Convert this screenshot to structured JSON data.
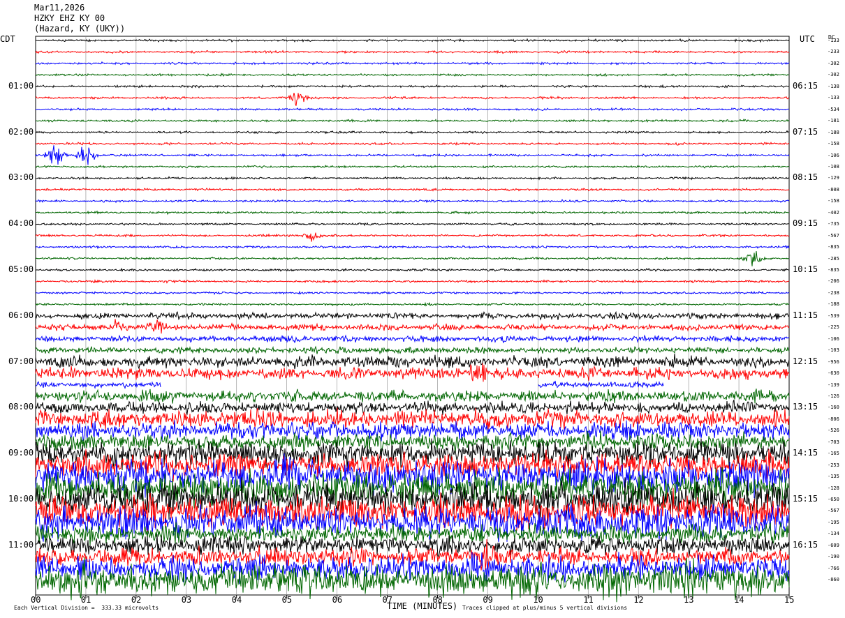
{
  "header": {
    "date": "Mar11,2026",
    "station": "HZKY EHZ KY 00",
    "location": "(Hazard, KY (UKY))"
  },
  "left_tz": "CDT",
  "right_tz": "UTC",
  "dc_label": "DC",
  "left_hours": [
    "01:00",
    "02:00",
    "03:00",
    "04:00",
    "05:00",
    "06:00",
    "07:00",
    "08:00",
    "09:00",
    "10:00",
    "11:00"
  ],
  "right_hours": [
    "06:15",
    "07:15",
    "08:15",
    "09:15",
    "10:15",
    "11:15",
    "12:15",
    "13:15",
    "14:15",
    "15:15",
    "16:15"
  ],
  "x_ticks": [
    "00",
    "01",
    "02",
    "03",
    "04",
    "05",
    "06",
    "07",
    "08",
    "09",
    "10",
    "11",
    "12",
    "13",
    "14",
    "15"
  ],
  "x_label": "TIME (MINUTES)",
  "footer_left": "Each Vertical Division =  333.33 microvolts",
  "footer_right": "Traces clipped at plus/minus 5 vertical divisions",
  "dc_offsets": [
    "-133",
    "-233",
    "-302",
    "-302",
    "-138",
    "-133",
    "-534",
    "-181",
    "-188",
    "-158",
    "-106",
    "-108",
    "-129",
    "-808",
    "-158",
    "-402",
    "-735",
    "-567",
    "-835",
    "-285",
    "-835",
    "-206",
    "-238",
    "-188",
    "-539",
    "-225",
    "-106",
    "-103",
    "-956",
    "-630",
    "-139",
    "-126",
    "-160",
    "-806",
    "-526",
    "-703",
    "-165",
    "-253",
    "-135",
    "-128",
    "-650",
    "-567",
    "-195",
    "-134",
    "-609",
    "-190",
    "-766",
    "-860"
  ],
  "chart_data": {
    "type": "line",
    "title": "",
    "xlabel": "TIME (MINUTES)",
    "ylabel": "",
    "xlim": [
      0,
      15
    ],
    "rows": 48,
    "minutes_per_row": 15,
    "colors": [
      "#000000",
      "#ff0000",
      "#0000ff",
      "#006600"
    ],
    "amplitude_level": [
      1,
      1,
      1,
      1,
      1,
      1,
      1,
      1,
      1,
      1,
      1,
      1,
      1,
      1,
      1,
      1,
      1,
      1,
      1,
      1,
      1,
      1,
      1,
      1,
      2,
      2,
      2,
      2,
      3,
      3,
      2,
      3,
      3,
      4,
      4,
      4,
      5,
      5,
      6,
      6,
      6,
      6,
      6,
      4,
      4,
      4,
      5,
      6
    ],
    "events": [
      {
        "row": 5,
        "minute": 5.2,
        "size": 3
      },
      {
        "row": 10,
        "minute": 1.0,
        "size": 5
      },
      {
        "row": 10,
        "minute": 0.4,
        "size": 4
      },
      {
        "row": 17,
        "minute": 5.5,
        "size": 2
      },
      {
        "row": 19,
        "minute": 14.3,
        "size": 3
      },
      {
        "row": 25,
        "minute": 1.6,
        "size": 3
      },
      {
        "row": 25,
        "minute": 2.4,
        "size": 3
      },
      {
        "row": 29,
        "minute": 8.8,
        "size": 4
      },
      {
        "row": 45,
        "minute": 9.0,
        "size": 5
      }
    ],
    "gaps": [
      {
        "row": 30,
        "from_minute": 2.5,
        "to_minute": 10.0
      },
      {
        "row": 30,
        "from_minute": 12.5,
        "to_minute": 15.0
      }
    ]
  }
}
